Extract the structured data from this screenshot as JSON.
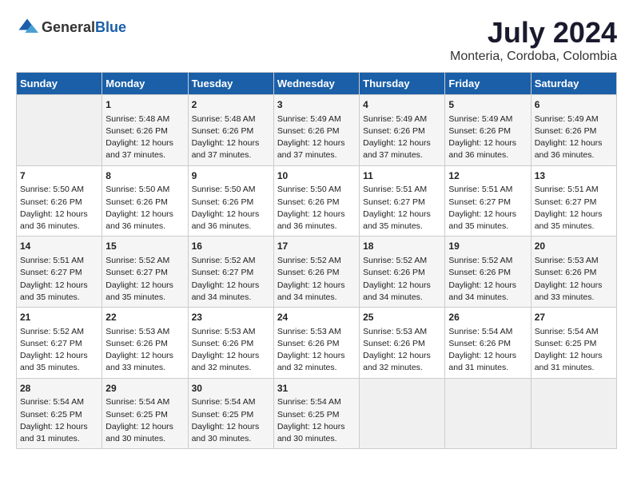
{
  "logo": {
    "text_general": "General",
    "text_blue": "Blue"
  },
  "title": "July 2024",
  "subtitle": "Monteria, Cordoba, Colombia",
  "weekdays": [
    "Sunday",
    "Monday",
    "Tuesday",
    "Wednesday",
    "Thursday",
    "Friday",
    "Saturday"
  ],
  "weeks": [
    [
      {
        "day": "",
        "info": ""
      },
      {
        "day": "1",
        "info": "Sunrise: 5:48 AM\nSunset: 6:26 PM\nDaylight: 12 hours\nand 37 minutes."
      },
      {
        "day": "2",
        "info": "Sunrise: 5:48 AM\nSunset: 6:26 PM\nDaylight: 12 hours\nand 37 minutes."
      },
      {
        "day": "3",
        "info": "Sunrise: 5:49 AM\nSunset: 6:26 PM\nDaylight: 12 hours\nand 37 minutes."
      },
      {
        "day": "4",
        "info": "Sunrise: 5:49 AM\nSunset: 6:26 PM\nDaylight: 12 hours\nand 37 minutes."
      },
      {
        "day": "5",
        "info": "Sunrise: 5:49 AM\nSunset: 6:26 PM\nDaylight: 12 hours\nand 36 minutes."
      },
      {
        "day": "6",
        "info": "Sunrise: 5:49 AM\nSunset: 6:26 PM\nDaylight: 12 hours\nand 36 minutes."
      }
    ],
    [
      {
        "day": "7",
        "info": ""
      },
      {
        "day": "8",
        "info": "Sunrise: 5:50 AM\nSunset: 6:26 PM\nDaylight: 12 hours\nand 36 minutes."
      },
      {
        "day": "9",
        "info": "Sunrise: 5:50 AM\nSunset: 6:26 PM\nDaylight: 12 hours\nand 36 minutes."
      },
      {
        "day": "10",
        "info": "Sunrise: 5:50 AM\nSunset: 6:26 PM\nDaylight: 12 hours\nand 36 minutes."
      },
      {
        "day": "11",
        "info": "Sunrise: 5:51 AM\nSunset: 6:27 PM\nDaylight: 12 hours\nand 35 minutes."
      },
      {
        "day": "12",
        "info": "Sunrise: 5:51 AM\nSunset: 6:27 PM\nDaylight: 12 hours\nand 35 minutes."
      },
      {
        "day": "13",
        "info": "Sunrise: 5:51 AM\nSunset: 6:27 PM\nDaylight: 12 hours\nand 35 minutes."
      }
    ],
    [
      {
        "day": "14",
        "info": ""
      },
      {
        "day": "15",
        "info": "Sunrise: 5:52 AM\nSunset: 6:27 PM\nDaylight: 12 hours\nand 35 minutes."
      },
      {
        "day": "16",
        "info": "Sunrise: 5:52 AM\nSunset: 6:27 PM\nDaylight: 12 hours\nand 34 minutes."
      },
      {
        "day": "17",
        "info": "Sunrise: 5:52 AM\nSunset: 6:26 PM\nDaylight: 12 hours\nand 34 minutes."
      },
      {
        "day": "18",
        "info": "Sunrise: 5:52 AM\nSunset: 6:26 PM\nDaylight: 12 hours\nand 34 minutes."
      },
      {
        "day": "19",
        "info": "Sunrise: 5:52 AM\nSunset: 6:26 PM\nDaylight: 12 hours\nand 34 minutes."
      },
      {
        "day": "20",
        "info": "Sunrise: 5:53 AM\nSunset: 6:26 PM\nDaylight: 12 hours\nand 33 minutes."
      }
    ],
    [
      {
        "day": "21",
        "info": ""
      },
      {
        "day": "22",
        "info": "Sunrise: 5:53 AM\nSunset: 6:26 PM\nDaylight: 12 hours\nand 33 minutes."
      },
      {
        "day": "23",
        "info": "Sunrise: 5:53 AM\nSunset: 6:26 PM\nDaylight: 12 hours\nand 32 minutes."
      },
      {
        "day": "24",
        "info": "Sunrise: 5:53 AM\nSunset: 6:26 PM\nDaylight: 12 hours\nand 32 minutes."
      },
      {
        "day": "25",
        "info": "Sunrise: 5:53 AM\nSunset: 6:26 PM\nDaylight: 12 hours\nand 32 minutes."
      },
      {
        "day": "26",
        "info": "Sunrise: 5:54 AM\nSunset: 6:26 PM\nDaylight: 12 hours\nand 31 minutes."
      },
      {
        "day": "27",
        "info": "Sunrise: 5:54 AM\nSunset: 6:25 PM\nDaylight: 12 hours\nand 31 minutes."
      }
    ],
    [
      {
        "day": "28",
        "info": "Sunrise: 5:54 AM\nSunset: 6:25 PM\nDaylight: 12 hours\nand 31 minutes."
      },
      {
        "day": "29",
        "info": "Sunrise: 5:54 AM\nSunset: 6:25 PM\nDaylight: 12 hours\nand 30 minutes."
      },
      {
        "day": "30",
        "info": "Sunrise: 5:54 AM\nSunset: 6:25 PM\nDaylight: 12 hours\nand 30 minutes."
      },
      {
        "day": "31",
        "info": "Sunrise: 5:54 AM\nSunset: 6:25 PM\nDaylight: 12 hours\nand 30 minutes."
      },
      {
        "day": "",
        "info": ""
      },
      {
        "day": "",
        "info": ""
      },
      {
        "day": "",
        "info": ""
      }
    ]
  ],
  "week1_sun_info": "Sunrise: 5:50 AM\nSunset: 6:26 PM\nDaylight: 12 hours\nand 36 minutes.",
  "week3_sun_info": "Sunrise: 5:51 AM\nSunset: 6:27 PM\nDaylight: 12 hours\nand 35 minutes.",
  "week4_sun_info": "Sunrise: 5:52 AM\nSunset: 6:27 PM\nDaylight: 12 hours\nand 35 minutes.",
  "week5_sun_info": "Sunrise: 5:53 AM\nSunset: 6:26 PM\nDaylight: 12 hours\nand 33 minutes."
}
